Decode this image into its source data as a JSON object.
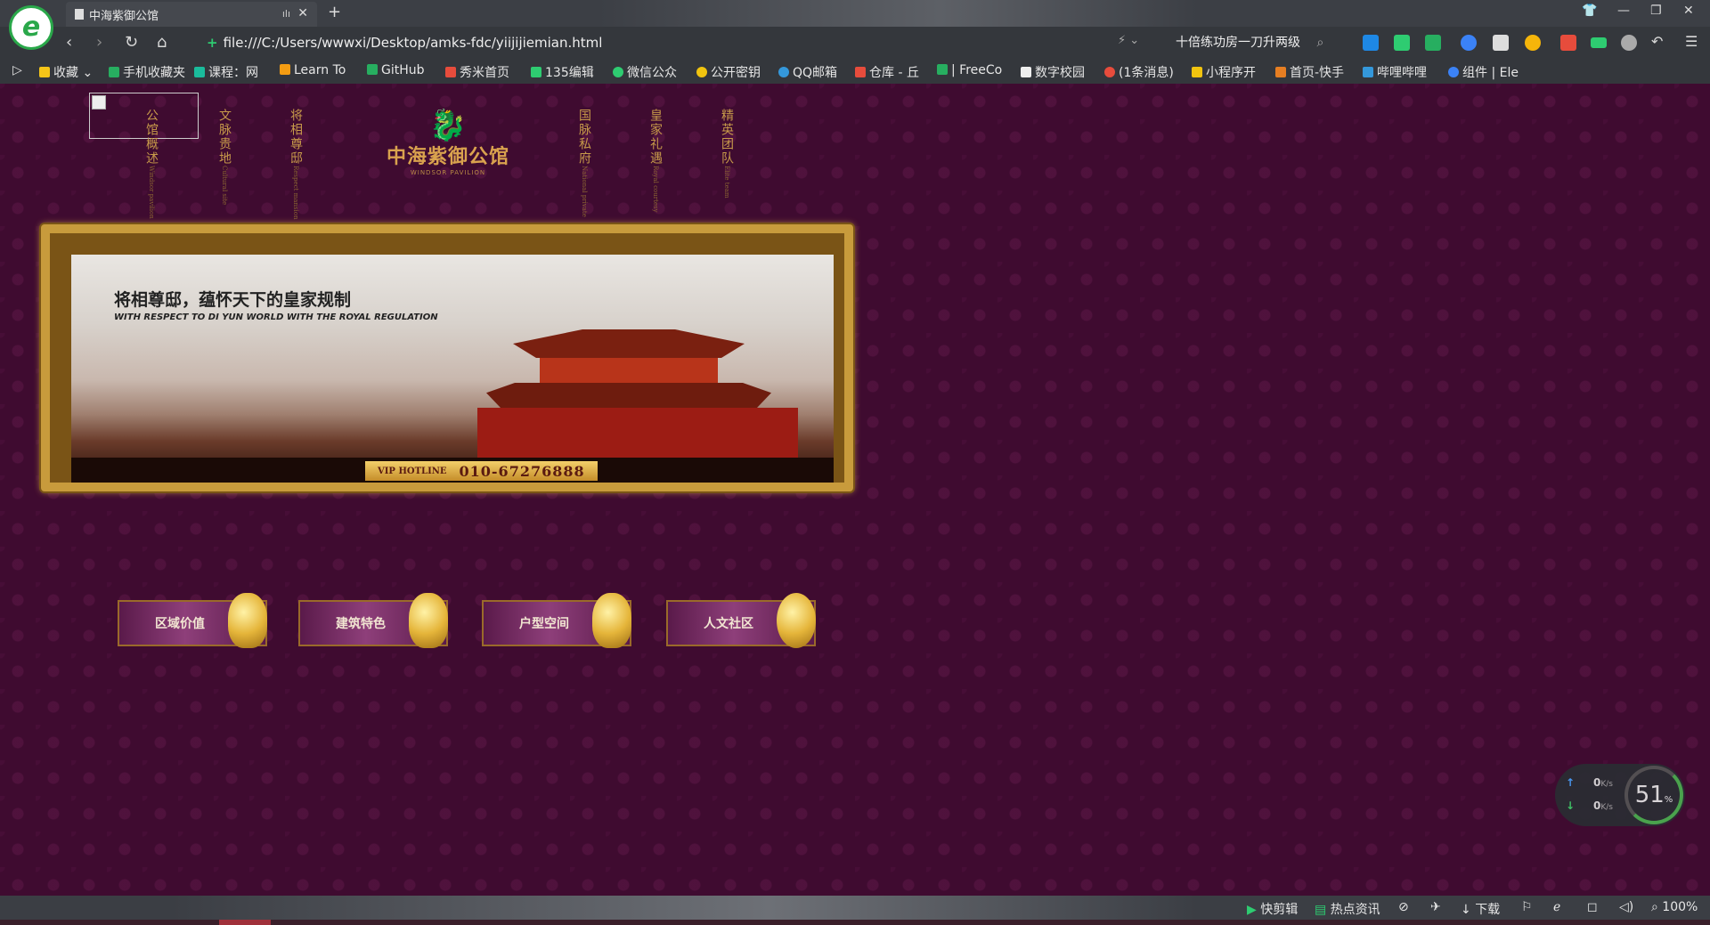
{
  "browser": {
    "tab_title": "中海紫御公馆",
    "url": "file:///C:/Users/wwwxi/Desktop/amks-fdc/yiijijiemian.html",
    "search_text": "十倍练功房一刀升两级",
    "bookmarks": [
      {
        "label": "收藏",
        "icon": "star-icon"
      },
      {
        "label": "手机收藏夹",
        "icon": "phone-icon"
      },
      {
        "label": "课程：网",
        "icon": "course-icon"
      },
      {
        "label": "Learn To",
        "icon": "learn-icon"
      },
      {
        "label": "GitHub",
        "icon": "github-icon"
      },
      {
        "label": "秀米首页",
        "icon": "xiumi-icon"
      },
      {
        "label": "135编辑",
        "icon": "editor-icon"
      },
      {
        "label": "微信公众",
        "icon": "wechat-icon"
      },
      {
        "label": "公开密钥",
        "icon": "key-icon"
      },
      {
        "label": "QQ邮箱",
        "icon": "qqmail-icon"
      },
      {
        "label": "仓库 - 丘",
        "icon": "repo-icon"
      },
      {
        "label": "| FreeCo",
        "icon": "freeco-icon"
      },
      {
        "label": "数字校园",
        "icon": "doc-icon"
      },
      {
        "label": "(1条消息)",
        "icon": "csdn-icon"
      },
      {
        "label": "小程序开",
        "icon": "miniprogram-icon"
      },
      {
        "label": "首页-快手",
        "icon": "kuaishou-icon"
      },
      {
        "label": "哔哩哔哩",
        "icon": "bilibili-icon"
      },
      {
        "label": "组件 | Ele",
        "icon": "element-icon"
      }
    ],
    "statusbar": {
      "quick_cut": "快剪辑",
      "hot_news": "热点资讯",
      "download": "下载",
      "zoom": "100%"
    }
  },
  "site": {
    "nav_left": [
      {
        "cn": "公馆概述",
        "en": "Windsor pavilion"
      },
      {
        "cn": "文脉贵地",
        "en": "Cultural site"
      },
      {
        "cn": "将相尊邸",
        "en": "Respect mansion"
      }
    ],
    "nav_right": [
      {
        "cn": "国脉私府",
        "en": "National private"
      },
      {
        "cn": "皇家礼遇",
        "en": "Royal courtesy"
      },
      {
        "cn": "精英团队",
        "en": "Elite team"
      }
    ],
    "brand_cn": "中海紫御公馆",
    "brand_en": "WINDSOR PAVILION",
    "banner": {
      "slogan_cn": "将相尊邸，蕴怀天下的皇家规制",
      "slogan_en": "WITH RESPECT TO DI YUN WORLD WITH THE ROYAL REGULATION",
      "hotline_label": "VIP HOTLINE",
      "hotline_number": "010-67276888"
    },
    "buttons": [
      "区域价值",
      "建筑特色",
      "户型空间",
      "人文社区"
    ]
  },
  "speed_widget": {
    "up": "0",
    "down": "0",
    "unit": "K/s",
    "percent": "51",
    "percent_sign": "%"
  }
}
